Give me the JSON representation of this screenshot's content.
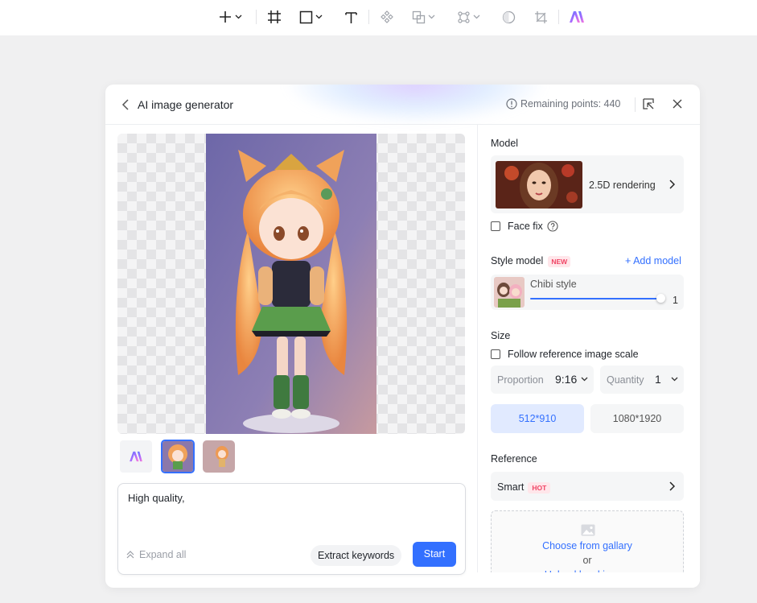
{
  "toolbar": {
    "icons": [
      "add-icon",
      "frame-icon",
      "rectangle-icon",
      "text-icon",
      "component-icon",
      "boolean-icon",
      "path-icon",
      "mask-icon",
      "crop-icon",
      "ai-logo-icon"
    ]
  },
  "dialog": {
    "title": "AI image generator",
    "remaining_points": "Remaining points: 440"
  },
  "left": {
    "prompt": "High quality,",
    "expand_label": "Expand all",
    "extract_label": "Extract keywords",
    "start_label": "Start"
  },
  "right": {
    "model": {
      "section_label": "Model",
      "name": "2.5D rendering",
      "face_fix_label": "Face fix"
    },
    "style_model": {
      "section_label": "Style model",
      "badge": "NEW",
      "add_label": "+ Add model",
      "style_name": "Chibi style",
      "strength": "1",
      "strength_fraction": 1.0
    },
    "size": {
      "section_label": "Size",
      "follow_label": "Follow reference image scale",
      "proportion_label": "Proportion",
      "proportion_value": "9:16",
      "quantity_label": "Quantity",
      "quantity_value": "1",
      "option_active": "512*910",
      "option_other": "1080*1920"
    },
    "reference": {
      "section_label": "Reference",
      "mode": "Smart",
      "badge": "HOT",
      "gallery_label": "Choose from gallary",
      "or_label": "or",
      "upload_label": "Upload local image"
    }
  },
  "colors": {
    "accent": "#3370ff",
    "badge_red": "#f04464"
  }
}
